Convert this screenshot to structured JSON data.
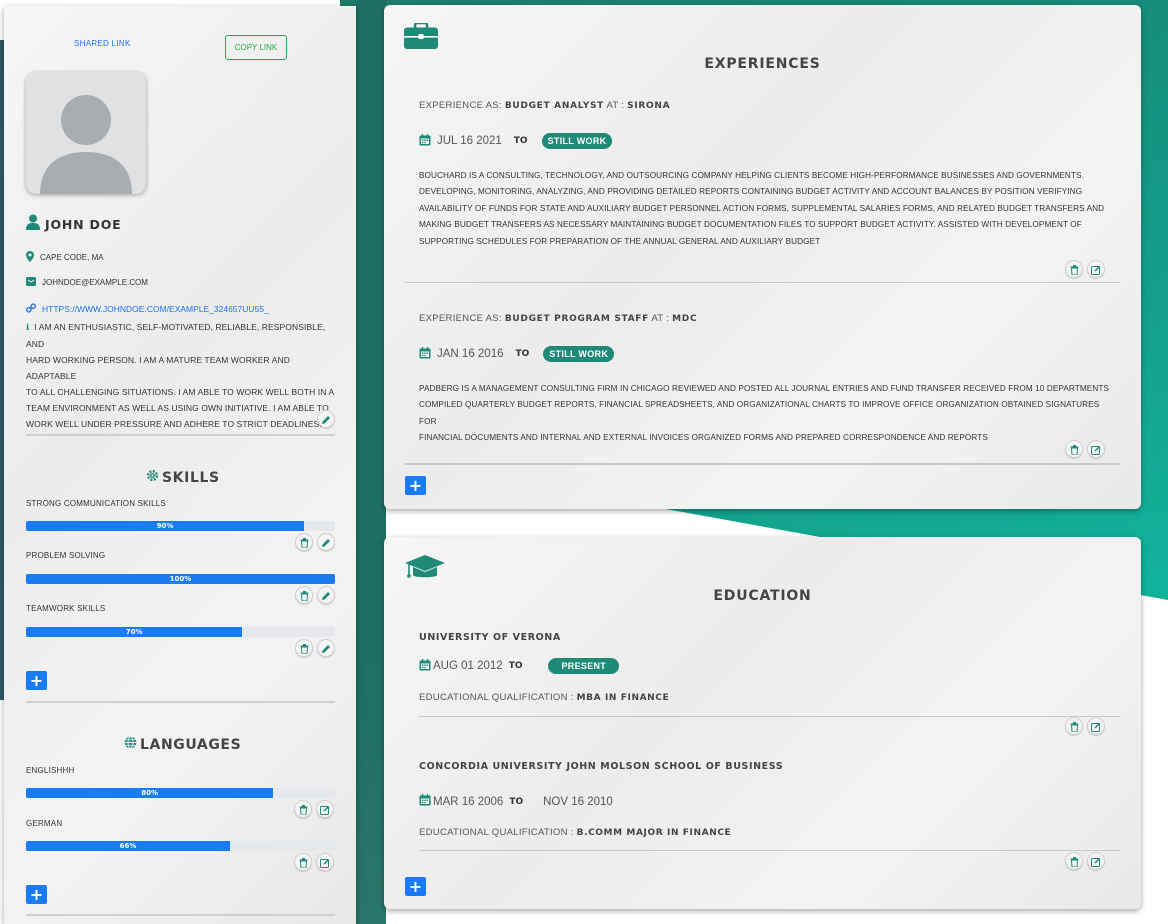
{
  "sidebar": {
    "shared_link_label": "SHARED LINK",
    "copy_link_label": "COPY LINK",
    "name": "JOHN DOE",
    "location": "CAPE CODE, MA",
    "email": "JOHNDOE@EXAMPLE.COM",
    "website": "HTTPS://WWW.JOHNDOE.COM/EXAMPLE_324657UU55_",
    "about_lines": [
      "I AM AN ENTHUSIASTIC, SELF-MOTIVATED, RELIABLE, RESPONSIBLE, AND",
      "HARD WORKING PERSON. I AM A MATURE TEAM WORKER AND ADAPTABLE",
      "TO ALL CHALLENGING SITUATIONS. I AM ABLE TO WORK WELL BOTH IN A",
      "TEAM ENVIRONMENT AS WELL AS USING OWN INITIATIVE. I AM ABLE TO",
      "WORK WELL UNDER PRESSURE AND ADHERE TO STRICT DEADLINES."
    ],
    "skills_title": "SKILLS",
    "skills": [
      {
        "label": "STRONG COMMUNICATION SKILLS",
        "percent_text": "90%",
        "level": 90
      },
      {
        "label": "PROBLEM SOLVING",
        "percent_text": "100%",
        "level": 100
      },
      {
        "label": "TEAMWORK SKILLS",
        "percent_text": "70%",
        "level": 70
      }
    ],
    "languages_title": "LANGUAGES",
    "languages": [
      {
        "label": "ENGLISHHH",
        "percent_text": "80%",
        "level": 80
      },
      {
        "label": "GERMAN",
        "percent_text": "66%",
        "level": 66
      }
    ],
    "add_label": "+"
  },
  "experiences": {
    "title": "EXPERIENCES",
    "head_prefix": "EXPERIENCE AS:",
    "at_label": "AT :",
    "to_label": "TO",
    "items": [
      {
        "role": "BUDGET ANALYST",
        "company": "SIRONA",
        "start": "JUL 16 2021",
        "status": "STILL WORK",
        "desc_lines": [
          "BOUCHARD IS A CONSULTING, TECHNOLOGY, AND OUTSOURCING COMPANY HELPING CLIENTS BECOME HIGH-PERFORMANCE BUSINESSES AND GOVERNMENTS.",
          "DEVELOPING, MONITORING, ANALYZING, AND PROVIDING DETAILED REPORTS CONTAINING BUDGET ACTIVITY AND ACCOUNT BALANCES BY POSITION VERIFYING",
          "AVAILABILITY OF FUNDS FOR STATE AND AUXILIARY BUDGET PERSONNEL ACTION FORMS, SUPPLEMENTAL SALARIES FORMS, AND RELATED BUDGET TRANSFERS AND",
          "MAKING BUDGET TRANSFERS AS NECESSARY MAINTAINING BUDGET DOCUMENTATION FILES TO SUPPORT BUDGET ACTIVITY. ASSISTED WITH DEVELOPMENT OF",
          "SUPPORTING SCHEDULES FOR PREPARATION OF THE ANNUAL GENERAL AND AUXILIARY BUDGET"
        ]
      },
      {
        "role": "BUDGET PROGRAM STAFF",
        "company": "MDC",
        "start": "JAN 16 2016",
        "status": "STILL WORK",
        "desc_lines": [
          "PADBERG IS A MANAGEMENT CONSULTING FIRM IN CHICAGO REVIEWED AND POSTED ALL JOURNAL ENTRIES AND FUND TRANSFER RECEIVED FROM 10 DEPARTMENTS",
          "COMPILED QUARTERLY BUDGET REPORTS, FINANCIAL SPREADSHEETS, AND ORGANIZATIONAL CHARTS TO IMPROVE OFFICE ORGANIZATION OBTAINED SIGNATURES FOR",
          "FINANCIAL DOCUMENTS AND INTERNAL AND EXTERNAL INVOICES ORGANIZED FORMS AND PREPARED CORRESPONDENCE AND REPORTS"
        ]
      }
    ]
  },
  "education": {
    "title": "EDUCATION",
    "qual_prefix": "EDUCATIONAL QUALIFICATION :",
    "to_label": "TO",
    "items": [
      {
        "school": "UNIVERSITY OF VERONA",
        "start": "AUG 01 2012",
        "end": "PRESENT",
        "qualification": "MBA IN FINANCE"
      },
      {
        "school": "CONCORDIA UNIVERSITY JOHN MOLSON SCHOOL OF BUSINESS",
        "start": "MAR 16 2006",
        "end": "NOV 16 2010",
        "qualification": "B.COMM MAJOR IN FINANCE"
      }
    ]
  },
  "colors": {
    "accent": "#1f8a77",
    "primary": "#1a7cf5",
    "link": "#1a73e8"
  }
}
